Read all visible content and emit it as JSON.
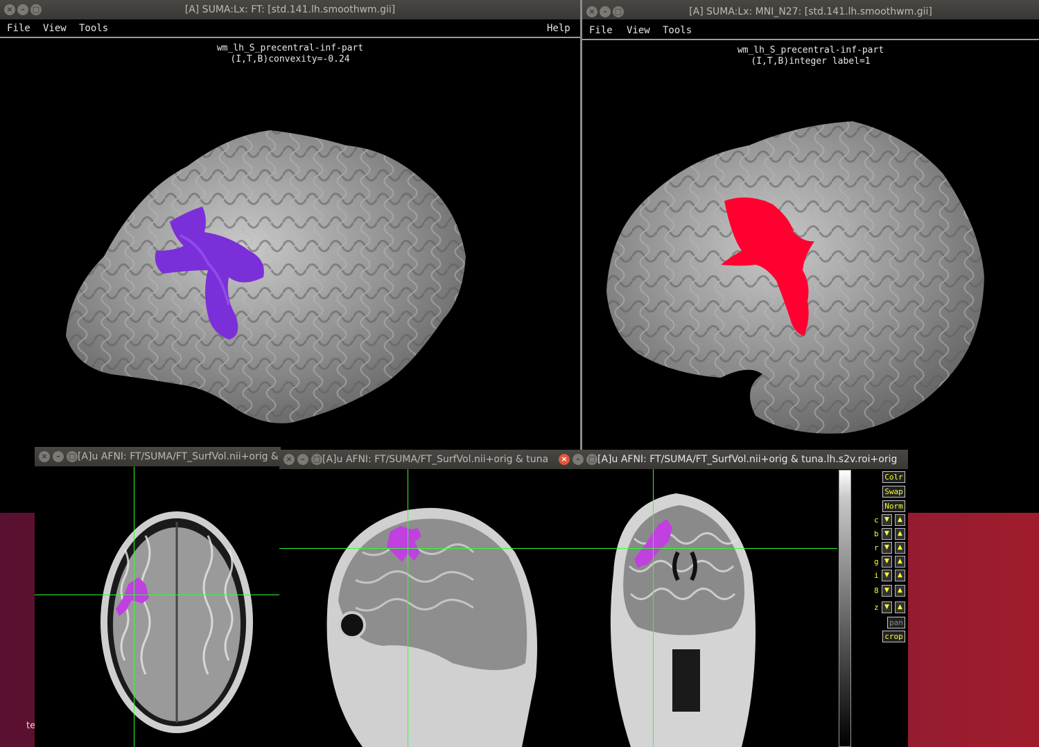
{
  "suma_left": {
    "title": "[A] SUMA:Lx: FT: [std.141.lh.smoothwm.gii]",
    "menu": [
      "File",
      "View",
      "Tools"
    ],
    "help": "Help",
    "caption_line1": "wm_lh_S_precentral-inf-part",
    "caption_line2": "(I,T,B)convexity=-0.24",
    "roi_color": "#7a2fd8"
  },
  "suma_right": {
    "title": "[A] SUMA:Lx: MNI_N27: [std.141.lh.smoothwm.gii]",
    "menu": [
      "File",
      "View",
      "Tools"
    ],
    "caption_line1": "wm_lh_S_precentral-inf-part",
    "caption_line2": "(I,T,B)integer label=1",
    "roi_color": "#ff0030"
  },
  "afni_axial": {
    "title": "[A]u AFNI: FT/SUMA/FT_SurfVol.nii+orig &"
  },
  "afni_sagittal": {
    "title": "[A]u AFNI: FT/SUMA/FT_SurfVol.nii+orig & tuna"
  },
  "afni_coronal": {
    "title": "[A]u AFNI: FT/SUMA/FT_SurfVol.nii+orig & tuna.lh.s2v.roi+orig"
  },
  "panel": {
    "buttons": [
      "Colr",
      "Swap",
      "Norm"
    ],
    "rows": [
      "c",
      "b",
      "r",
      "g",
      "i",
      "8",
      "z"
    ],
    "pan": "pan",
    "crop": "crop"
  },
  "terminal_fragment": "te",
  "colors": {
    "crosshair": "#30ff30",
    "roi_volume": "#c040e0",
    "panel_text": "#ffff30"
  }
}
